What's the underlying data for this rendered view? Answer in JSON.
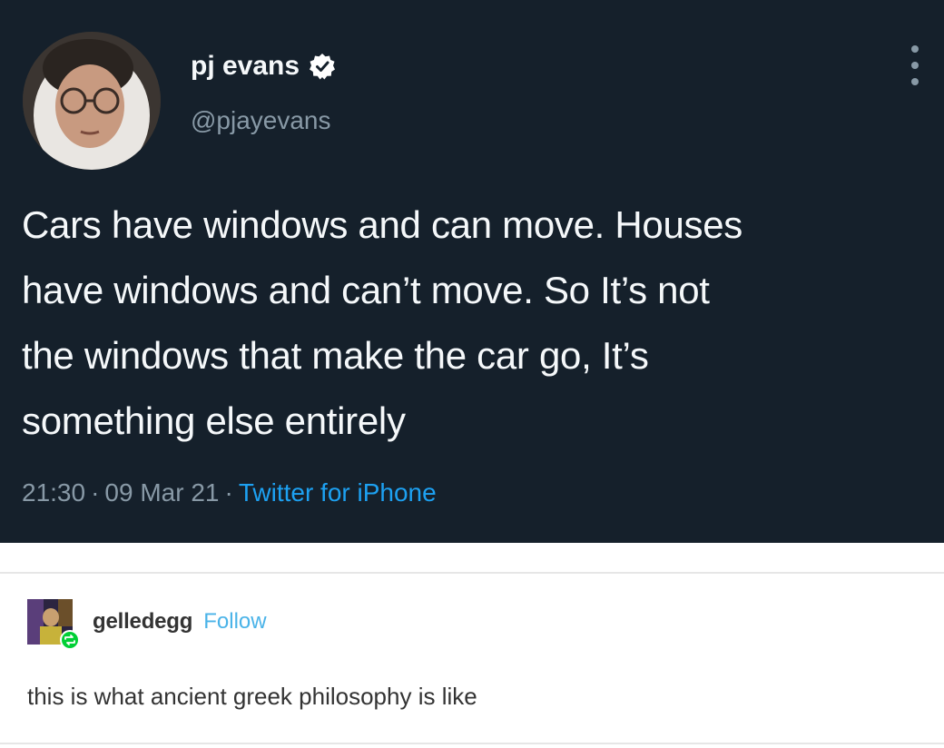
{
  "tweet": {
    "display_name": "pj evans",
    "handle": "@pjayevans",
    "verified_icon": "verified-badge-icon",
    "more_icon": "more-options-icon",
    "text_lines": [
      "Cars have windows and can move. Houses",
      "have windows and can’t move. So It’s not",
      "the windows that make the car go, It’s",
      "something else entirely"
    ],
    "time": "21:30",
    "date": "09 Mar 21",
    "separator": "·",
    "source": "Twitter for iPhone",
    "colors": {
      "background": "#15202b",
      "text": "#f5f8fa",
      "secondary": "#8899a6",
      "link": "#1da1f2"
    }
  },
  "reblog": {
    "username": "gelledegg",
    "follow_label": "Follow",
    "text": "this is what ancient greek philosophy is like",
    "colors": {
      "text": "#333333",
      "link": "#4ab3e8"
    }
  }
}
